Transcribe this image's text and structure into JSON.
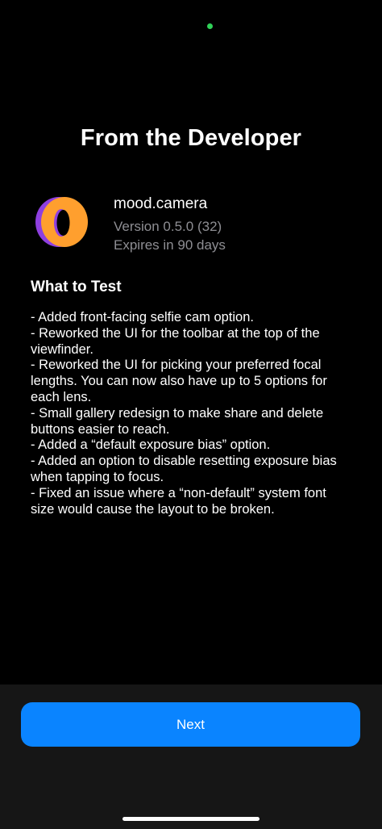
{
  "status": {
    "camera_indicator_color": "#30d158"
  },
  "header": {
    "title": "From the Developer"
  },
  "app": {
    "icon": "mood-camera-app-icon",
    "name": "mood.camera",
    "version": "Version 0.5.0 (32)",
    "expires": "Expires in 90 days"
  },
  "notes": {
    "title": "What to Test",
    "lines": [
      "- Added front-facing selfie cam option.",
      "- Reworked the UI for the toolbar at the top of the",
      "viewfinder.",
      "- Reworked the UI for picking your preferred focal",
      "lengths. You can now also have up to 5 options for",
      "each lens.",
      "- Small gallery redesign to make share and delete",
      "buttons easier to reach.",
      "- Added a “default exposure bias” option.",
      "- Added an option to disable resetting exposure bias",
      "when tapping to focus.",
      "- Fixed an issue where a “non-default” system font",
      "size would cause the layout to be broken."
    ]
  },
  "footer": {
    "next_label": "Next"
  },
  "colors": {
    "background": "#000000",
    "footer_background": "#161616",
    "accent": "#0a84ff",
    "secondary_text": "#8e8e93",
    "icon_orange": "#ff9f2e",
    "icon_purple": "#8e3fe0"
  }
}
